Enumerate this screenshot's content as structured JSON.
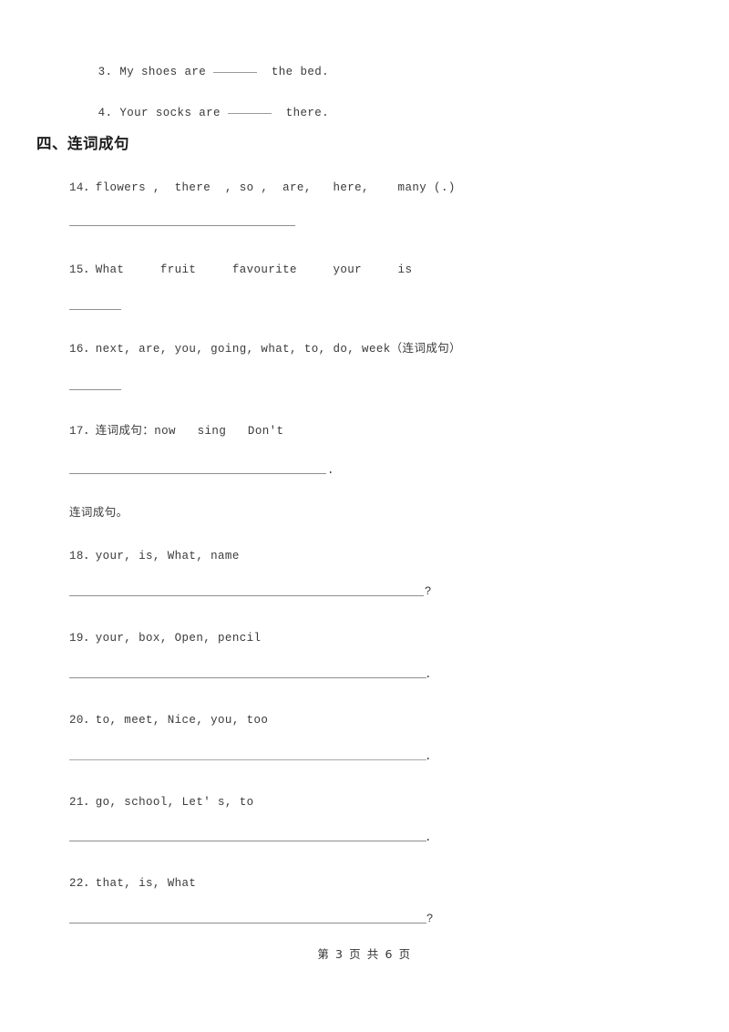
{
  "document": {
    "kind": "worksheet-page",
    "carryover_items": [
      {
        "number": "3.",
        "text_before": "My shoes are",
        "text_after": "the bed."
      },
      {
        "number": "4.",
        "text_before": "Your socks are",
        "text_after": "there."
      }
    ],
    "section": {
      "heading": "四、连词成句"
    },
    "instruction_note": "连词成句。",
    "questions": [
      {
        "id": "q14",
        "label": "14．flowers ,  there  , so ,  are,   here,    many (.)"
      },
      {
        "id": "q15",
        "label": "15．What     fruit     favourite     your     is"
      },
      {
        "id": "q16",
        "label": "16．next, are, you, going, what, to, do, week（连词成句）"
      },
      {
        "id": "q17",
        "label": "17．连词成句：now   sing   Don't"
      },
      {
        "id": "q18",
        "label": "18．your, is, What, name"
      },
      {
        "id": "q19",
        "label": "19．your, box, Open, pencil"
      },
      {
        "id": "q20",
        "label": "20．to, meet, Nice, you, too"
      },
      {
        "id": "q21",
        "label": "21．go, school, Let' s, to"
      },
      {
        "id": "q22",
        "label": "22．that, is, What"
      }
    ],
    "answer_line_punctuation": {
      "q17": ".",
      "q18": "?",
      "q19": ".",
      "q20": ".",
      "q21": ".",
      "q22": "?"
    },
    "footer": {
      "text": "第 3 页 共 6 页"
    }
  }
}
